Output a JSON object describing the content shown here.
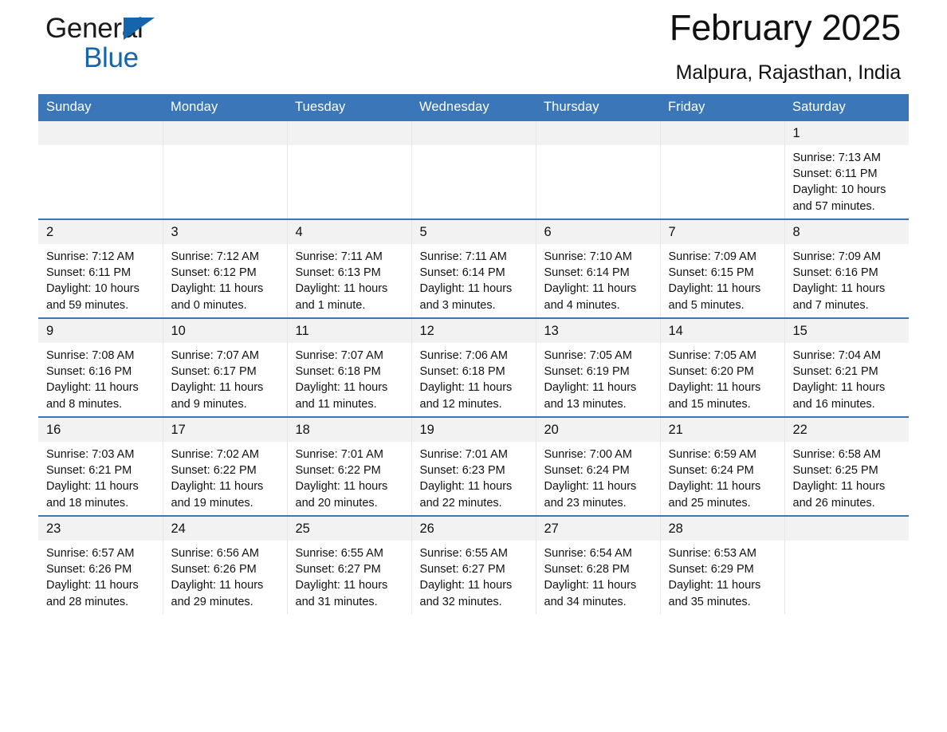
{
  "brand": {
    "word1": "General",
    "word2": "Blue",
    "triangle_color": "#1565ad"
  },
  "header": {
    "title": "February 2025",
    "subtitle": "Malpura, Rajasthan, India"
  },
  "colors": {
    "header_blue": "#3a76b8",
    "row_divider_blue": "#3a76b8",
    "daynum_band": "#f2f2f2",
    "text": "#111111"
  },
  "calendar": {
    "weekdays": [
      "Sunday",
      "Monday",
      "Tuesday",
      "Wednesday",
      "Thursday",
      "Friday",
      "Saturday"
    ],
    "weeks": [
      [
        {
          "day": "",
          "lines": []
        },
        {
          "day": "",
          "lines": []
        },
        {
          "day": "",
          "lines": []
        },
        {
          "day": "",
          "lines": []
        },
        {
          "day": "",
          "lines": []
        },
        {
          "day": "",
          "lines": []
        },
        {
          "day": "1",
          "lines": [
            "Sunrise: 7:13 AM",
            "Sunset: 6:11 PM",
            "Daylight: 10 hours and 57 minutes."
          ]
        }
      ],
      [
        {
          "day": "2",
          "lines": [
            "Sunrise: 7:12 AM",
            "Sunset: 6:11 PM",
            "Daylight: 10 hours and 59 minutes."
          ]
        },
        {
          "day": "3",
          "lines": [
            "Sunrise: 7:12 AM",
            "Sunset: 6:12 PM",
            "Daylight: 11 hours and 0 minutes."
          ]
        },
        {
          "day": "4",
          "lines": [
            "Sunrise: 7:11 AM",
            "Sunset: 6:13 PM",
            "Daylight: 11 hours and 1 minute."
          ]
        },
        {
          "day": "5",
          "lines": [
            "Sunrise: 7:11 AM",
            "Sunset: 6:14 PM",
            "Daylight: 11 hours and 3 minutes."
          ]
        },
        {
          "day": "6",
          "lines": [
            "Sunrise: 7:10 AM",
            "Sunset: 6:14 PM",
            "Daylight: 11 hours and 4 minutes."
          ]
        },
        {
          "day": "7",
          "lines": [
            "Sunrise: 7:09 AM",
            "Sunset: 6:15 PM",
            "Daylight: 11 hours and 5 minutes."
          ]
        },
        {
          "day": "8",
          "lines": [
            "Sunrise: 7:09 AM",
            "Sunset: 6:16 PM",
            "Daylight: 11 hours and 7 minutes."
          ]
        }
      ],
      [
        {
          "day": "9",
          "lines": [
            "Sunrise: 7:08 AM",
            "Sunset: 6:16 PM",
            "Daylight: 11 hours and 8 minutes."
          ]
        },
        {
          "day": "10",
          "lines": [
            "Sunrise: 7:07 AM",
            "Sunset: 6:17 PM",
            "Daylight: 11 hours and 9 minutes."
          ]
        },
        {
          "day": "11",
          "lines": [
            "Sunrise: 7:07 AM",
            "Sunset: 6:18 PM",
            "Daylight: 11 hours and 11 minutes."
          ]
        },
        {
          "day": "12",
          "lines": [
            "Sunrise: 7:06 AM",
            "Sunset: 6:18 PM",
            "Daylight: 11 hours and 12 minutes."
          ]
        },
        {
          "day": "13",
          "lines": [
            "Sunrise: 7:05 AM",
            "Sunset: 6:19 PM",
            "Daylight: 11 hours and 13 minutes."
          ]
        },
        {
          "day": "14",
          "lines": [
            "Sunrise: 7:05 AM",
            "Sunset: 6:20 PM",
            "Daylight: 11 hours and 15 minutes."
          ]
        },
        {
          "day": "15",
          "lines": [
            "Sunrise: 7:04 AM",
            "Sunset: 6:21 PM",
            "Daylight: 11 hours and 16 minutes."
          ]
        }
      ],
      [
        {
          "day": "16",
          "lines": [
            "Sunrise: 7:03 AM",
            "Sunset: 6:21 PM",
            "Daylight: 11 hours and 18 minutes."
          ]
        },
        {
          "day": "17",
          "lines": [
            "Sunrise: 7:02 AM",
            "Sunset: 6:22 PM",
            "Daylight: 11 hours and 19 minutes."
          ]
        },
        {
          "day": "18",
          "lines": [
            "Sunrise: 7:01 AM",
            "Sunset: 6:22 PM",
            "Daylight: 11 hours and 20 minutes."
          ]
        },
        {
          "day": "19",
          "lines": [
            "Sunrise: 7:01 AM",
            "Sunset: 6:23 PM",
            "Daylight: 11 hours and 22 minutes."
          ]
        },
        {
          "day": "20",
          "lines": [
            "Sunrise: 7:00 AM",
            "Sunset: 6:24 PM",
            "Daylight: 11 hours and 23 minutes."
          ]
        },
        {
          "day": "21",
          "lines": [
            "Sunrise: 6:59 AM",
            "Sunset: 6:24 PM",
            "Daylight: 11 hours and 25 minutes."
          ]
        },
        {
          "day": "22",
          "lines": [
            "Sunrise: 6:58 AM",
            "Sunset: 6:25 PM",
            "Daylight: 11 hours and 26 minutes."
          ]
        }
      ],
      [
        {
          "day": "23",
          "lines": [
            "Sunrise: 6:57 AM",
            "Sunset: 6:26 PM",
            "Daylight: 11 hours and 28 minutes."
          ]
        },
        {
          "day": "24",
          "lines": [
            "Sunrise: 6:56 AM",
            "Sunset: 6:26 PM",
            "Daylight: 11 hours and 29 minutes."
          ]
        },
        {
          "day": "25",
          "lines": [
            "Sunrise: 6:55 AM",
            "Sunset: 6:27 PM",
            "Daylight: 11 hours and 31 minutes."
          ]
        },
        {
          "day": "26",
          "lines": [
            "Sunrise: 6:55 AM",
            "Sunset: 6:27 PM",
            "Daylight: 11 hours and 32 minutes."
          ]
        },
        {
          "day": "27",
          "lines": [
            "Sunrise: 6:54 AM",
            "Sunset: 6:28 PM",
            "Daylight: 11 hours and 34 minutes."
          ]
        },
        {
          "day": "28",
          "lines": [
            "Sunrise: 6:53 AM",
            "Sunset: 6:29 PM",
            "Daylight: 11 hours and 35 minutes."
          ]
        },
        {
          "day": "",
          "lines": []
        }
      ]
    ]
  }
}
